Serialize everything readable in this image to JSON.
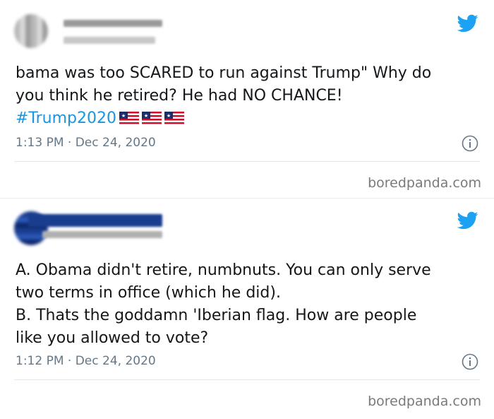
{
  "tweets": [
    {
      "text": "bama was too SCARED to run against Trump\" Why do\nyou think he retired? He had NO CHANCE!",
      "hashtag": "#Trump2020",
      "flags": [
        "flag-icon",
        "flag-icon",
        "flag-icon"
      ],
      "timestamp": "1:13 PM · Dec 24, 2020"
    },
    {
      "text": "A. Obama didn't retire, numbnuts. You can only serve\ntwo terms in office (which he did).\nB. Thats the goddamn 'Iberian flag. How are people\nlike you allowed to vote?",
      "timestamp": "1:12 PM · Dec 24, 2020"
    }
  ],
  "watermark": "boredpanda.com",
  "colors": {
    "twitter_blue": "#1da1f2",
    "hashtag_blue": "#1b95e0",
    "meta_grey": "#657786",
    "text": "#14171a"
  },
  "icons": [
    "twitter-bird-icon",
    "info-icon",
    "flag-icon"
  ]
}
